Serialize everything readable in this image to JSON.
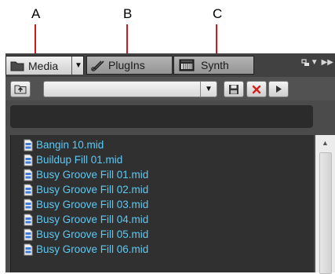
{
  "callouts": [
    "A",
    "B",
    "C"
  ],
  "tabs": {
    "media": {
      "label": "Media",
      "icon": "folder-icon"
    },
    "plugins": {
      "label": "PlugIns",
      "icon": "plugin-icon"
    },
    "synth": {
      "label": "Synth",
      "icon": "keyboard-icon"
    }
  },
  "toolbar": {
    "combo_value": ""
  },
  "path": "",
  "files": [
    "Bangin 10.mid",
    "Buildup Fill 01.mid",
    "Busy Groove Fill 01.mid",
    "Busy Groove Fill 02.mid",
    "Busy Groove Fill 03.mid",
    "Busy Groove Fill 04.mid",
    "Busy Groove Fill 05.mid",
    "Busy Groove Fill 06.mid"
  ],
  "colors": {
    "callout_line": "#d8151c",
    "file_text": "#5cc9f5",
    "panel_bg": "#4b4b4b",
    "delete_x": "#d21f1f"
  }
}
